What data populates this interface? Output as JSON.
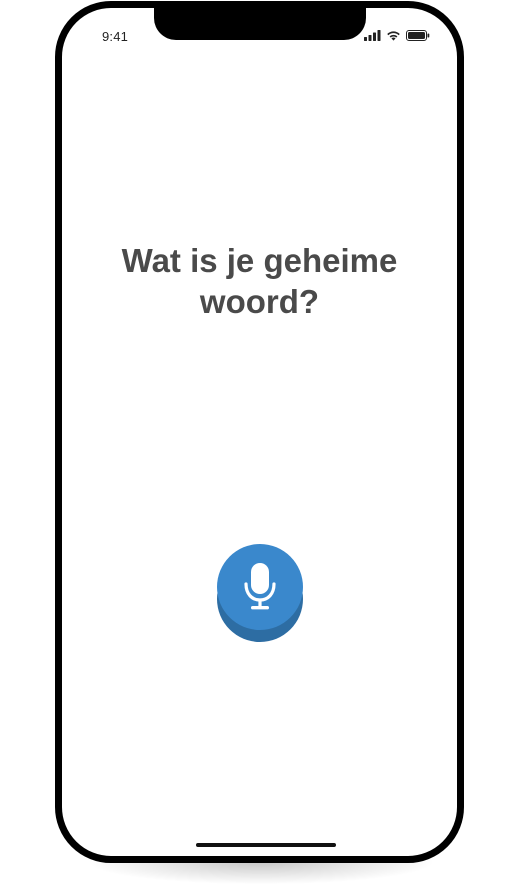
{
  "status_bar": {
    "time": "9:41",
    "icons": [
      "signal-icon",
      "wifi-icon",
      "battery-icon"
    ]
  },
  "main": {
    "question": "Wat is je geheime woord?"
  },
  "mic_button": {
    "icon": "microphone-icon",
    "color": "#3a88cc",
    "shadow_color": "#2d6da3"
  },
  "colors": {
    "text": "#4a4a4a",
    "frame": "#000000",
    "screen": "#ffffff"
  }
}
